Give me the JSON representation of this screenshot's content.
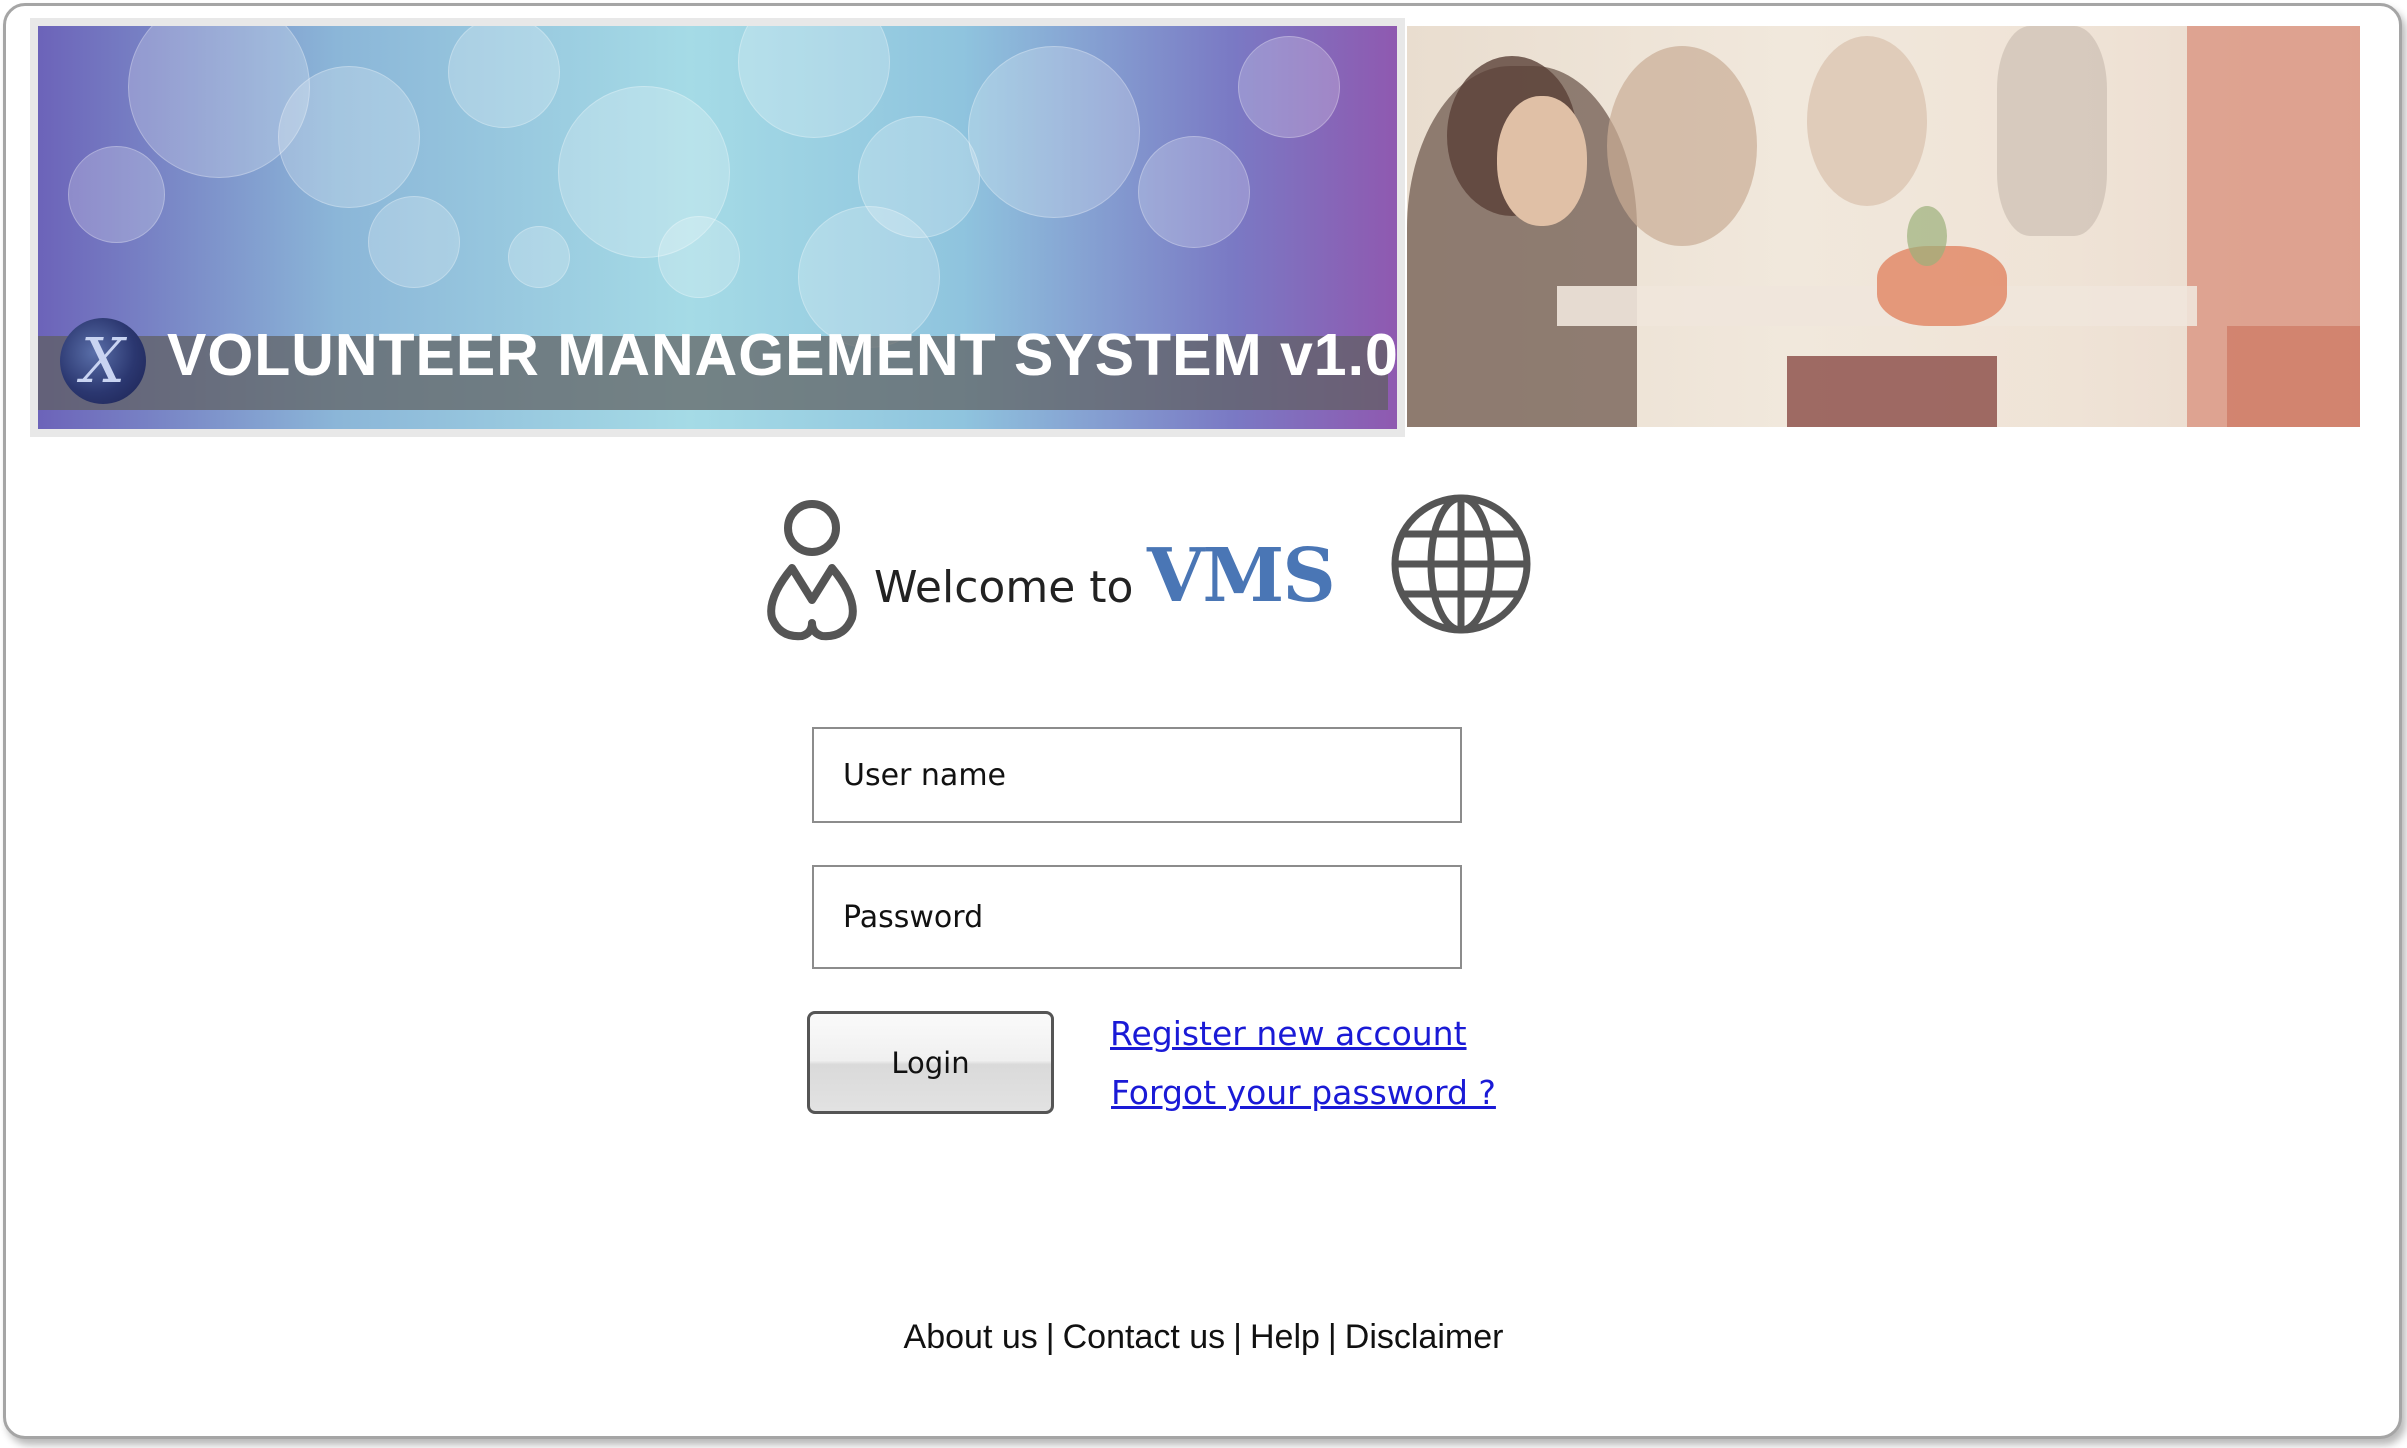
{
  "header": {
    "title": "VOLUNTEER MANAGEMENT SYSTEM v1.0",
    "logo_glyph": "X",
    "logo_icon": "x-emblem-logo",
    "photo": "volunteers-at-table-photo"
  },
  "welcome": {
    "text": "Welcome to",
    "brand": "VMS",
    "brand_color": "#4a76b5",
    "user_icon": "person-icon",
    "globe_icon": "globe-icon"
  },
  "form": {
    "username_placeholder": "User name",
    "password_placeholder": "Password",
    "login_label": "Login",
    "register_link": "Register new account",
    "forgot_link": "Forgot your password ?",
    "link_color": "#1a1ad6"
  },
  "footer": {
    "about": "About us",
    "contact": "Contact us",
    "help": "Help",
    "disclaimer": "Disclaimer",
    "separator": "|"
  }
}
